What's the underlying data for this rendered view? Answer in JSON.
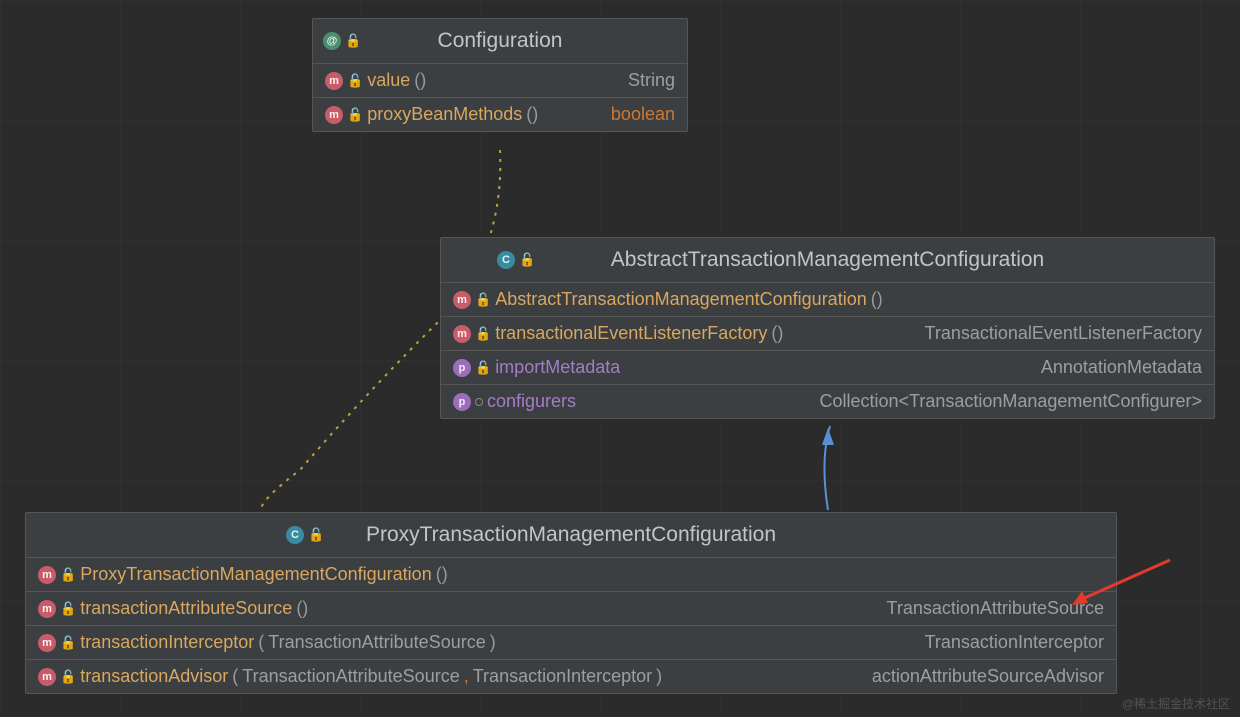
{
  "watermark": "@稀土掘金技术社区",
  "boxes": {
    "configuration": {
      "title": "Configuration",
      "header_badge": "@",
      "rows": [
        {
          "badge": "m",
          "name": "value",
          "parens": "()",
          "ret": "String",
          "ret_kw": false
        },
        {
          "badge": "m",
          "name": "proxyBeanMethods",
          "parens": "()",
          "ret": "boolean",
          "ret_kw": true
        }
      ]
    },
    "abstract": {
      "title": "AbstractTransactionManagementConfiguration",
      "header_badge": "C",
      "rows": [
        {
          "badge": "m",
          "name": "AbstractTransactionManagementConfiguration",
          "parens": "()",
          "ret": "",
          "ret_kw": false
        },
        {
          "badge": "m",
          "name": "transactionalEventListenerFactory",
          "parens": "()",
          "ret": "TransactionalEventListenerFactory",
          "ret_kw": false
        },
        {
          "badge": "p",
          "name": "importMetadata",
          "parens": "",
          "ret": "AnnotationMetadata",
          "ret_kw": false,
          "prop": true
        },
        {
          "badge": "p",
          "name": "configurers",
          "parens": "",
          "ret": "Collection<TransactionManagementConfigurer>",
          "ret_kw": false,
          "prop": true,
          "circle": true
        }
      ]
    },
    "proxy": {
      "title": "ProxyTransactionManagementConfiguration",
      "header_badge": "C",
      "rows": [
        {
          "badge": "m",
          "name": "ProxyTransactionManagementConfiguration",
          "parens": "()",
          "ret": "",
          "ret_kw": false
        },
        {
          "badge": "m",
          "name": "transactionAttributeSource",
          "parens": "()",
          "ret": "TransactionAttributeSource",
          "ret_kw": false
        },
        {
          "badge": "m",
          "name": "transactionInterceptor",
          "parens": "(",
          "params": "TransactionAttributeSource",
          "close": ")",
          "ret": "TransactionInterceptor",
          "ret_kw": false
        },
        {
          "badge": "m",
          "name": "transactionAdvisor",
          "parens": "(",
          "params2": [
            "TransactionAttributeSource",
            "TransactionInterceptor"
          ],
          "close": ")",
          "ret": "actionAttributeSourceAdvisor",
          "ret_kw": false
        }
      ]
    }
  }
}
